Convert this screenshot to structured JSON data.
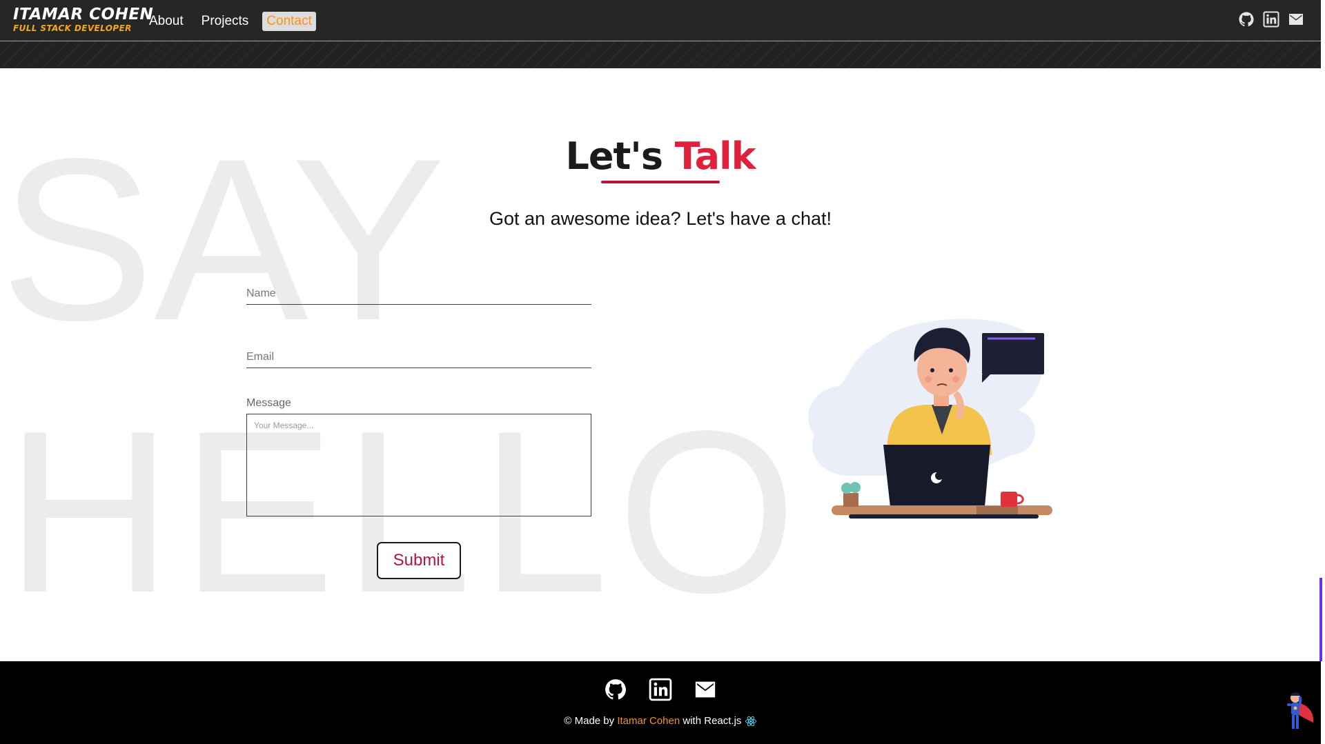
{
  "brand": {
    "name": "ITAMAR COHEN",
    "tagline": "FULL STACK DEVELOPER"
  },
  "nav": {
    "links": [
      {
        "label": "About"
      },
      {
        "label": "Projects"
      },
      {
        "label": "Contact",
        "active": true
      }
    ],
    "social_icons": [
      "github-icon",
      "linkedin-icon",
      "mail-icon"
    ]
  },
  "background_words": {
    "line1": "SAY",
    "line2": "HELLO"
  },
  "heading": {
    "part1": "Let's",
    "part2": "Talk"
  },
  "subtitle": "Got an awesome idea? Let's have a chat!",
  "form": {
    "name_placeholder": "Name",
    "email_placeholder": "Email",
    "message_label": "Message",
    "message_placeholder": "Your Message...",
    "submit_label": "Submit"
  },
  "footer": {
    "social_icons": [
      "github-icon",
      "linkedin-icon",
      "mail-icon"
    ],
    "credit_prefix": "© Made by",
    "author": "Itamar Cohen",
    "credit_suffix": "with React.js"
  },
  "colors": {
    "accent_orange": "#f7931e",
    "accent_red": "#e0213c",
    "underline": "#b7133d",
    "navbar_bg": "#222222",
    "footer_bg": "#000000",
    "scroll_accent": "#6a2ff0"
  }
}
